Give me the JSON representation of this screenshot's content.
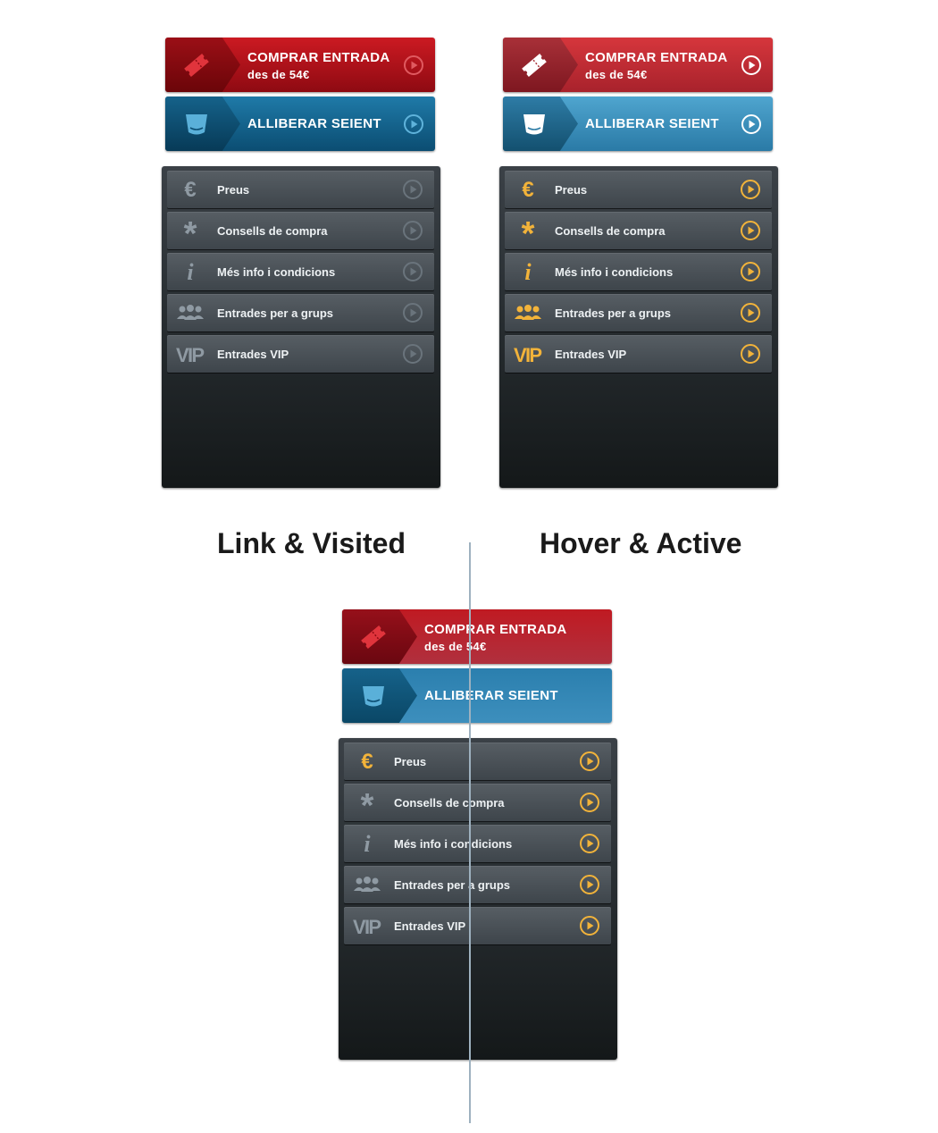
{
  "buy_button": {
    "title": "COMPRAR ENTRADA",
    "price": "des de 54€"
  },
  "release_button": {
    "label": "ALLIBERAR SEIENT"
  },
  "menu_items": [
    {
      "label": "Preus",
      "icon": "euro-icon"
    },
    {
      "label": "Consells de compra",
      "icon": "asterisk-icon"
    },
    {
      "label": "Més info i condicions",
      "icon": "info-icon"
    },
    {
      "label": "Entrades per a grups",
      "icon": "group-icon"
    },
    {
      "label": "Entrades VIP",
      "icon": "vip-icon"
    }
  ],
  "headings": {
    "link": "Link & Visited",
    "hover": "Hover & Active"
  },
  "icons": {
    "vip_text": "VIP",
    "info_text": "i",
    "euro_text": "€",
    "asterisk_text": "*"
  },
  "colors": {
    "buy_red": "#cc1a22",
    "release_blue": "#1f7aa8",
    "accent_gold": "#f2b33a",
    "link_icon_gray": "#8f9aa3",
    "divider": "#9eb1bf"
  }
}
